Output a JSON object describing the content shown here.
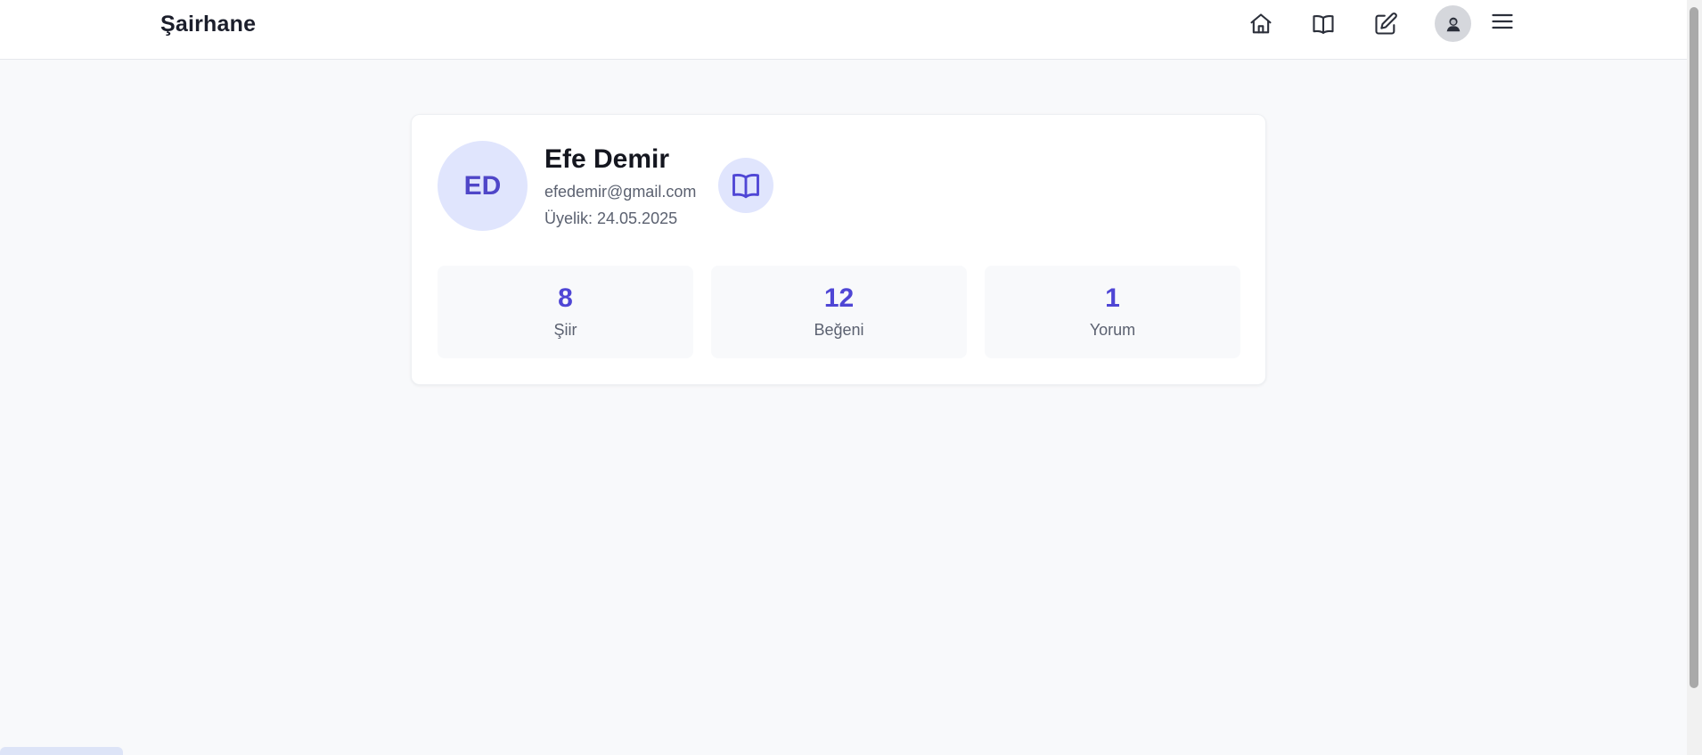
{
  "navbar": {
    "brand": "Şairhane",
    "icons": [
      "home-icon",
      "book-open-icon",
      "edit-icon",
      "user-avatar-icon",
      "menu-icon"
    ]
  },
  "profile": {
    "initials": "ED",
    "name": "Efe Demir",
    "email": "efedemir@gmail.com",
    "member_since": "Üyelik: 24.05.2025",
    "badge_icon": "book-open-icon"
  },
  "stats": [
    {
      "value": "8",
      "label": "Şiir"
    },
    {
      "value": "12",
      "label": "Beğeni"
    },
    {
      "value": "1",
      "label": "Yorum"
    }
  ],
  "colors": {
    "accent": "#4f46d5",
    "avatar_bg": "#e0e5fd",
    "page_bg": "#f8f9fb",
    "text_dark": "#14161f",
    "text_muted": "#5b6170"
  }
}
